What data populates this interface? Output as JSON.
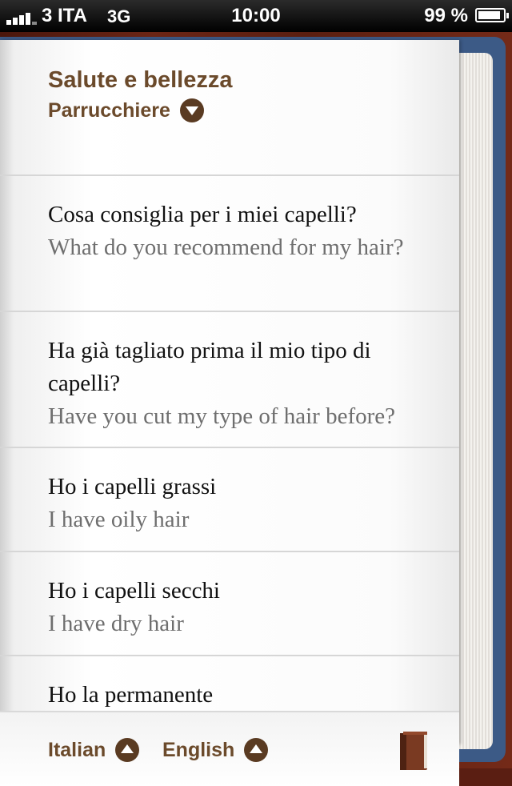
{
  "status_bar": {
    "carrier": "3 ITA",
    "network": "3G",
    "time": "10:00",
    "battery_percent": "99 %"
  },
  "header": {
    "category": "Salute e bellezza",
    "subcategory": "Parrucchiere"
  },
  "phrases": [
    {
      "italian": "Cosa consiglia per i miei capelli?",
      "english": "What do you recommend for my hair?"
    },
    {
      "italian": "Ha già tagliato prima il mio tipo di capelli?",
      "english": "Have you cut my type of hair before?"
    },
    {
      "italian": "Ho i capelli grassi",
      "english": "I have oily hair"
    },
    {
      "italian": "Ho i capelli secchi",
      "english": "I have dry hair"
    },
    {
      "italian": "Ho la permanente",
      "english": ""
    }
  ],
  "footer": {
    "source_language": "Italian",
    "target_language": "English"
  },
  "colors": {
    "brown_text": "#6b4a2b",
    "cover_blue": "#3c5a86"
  },
  "icons": {
    "subcategory_toggle": "chevron-down-icon",
    "language_selector": "chevron-up-icon",
    "book": "book-icon"
  }
}
